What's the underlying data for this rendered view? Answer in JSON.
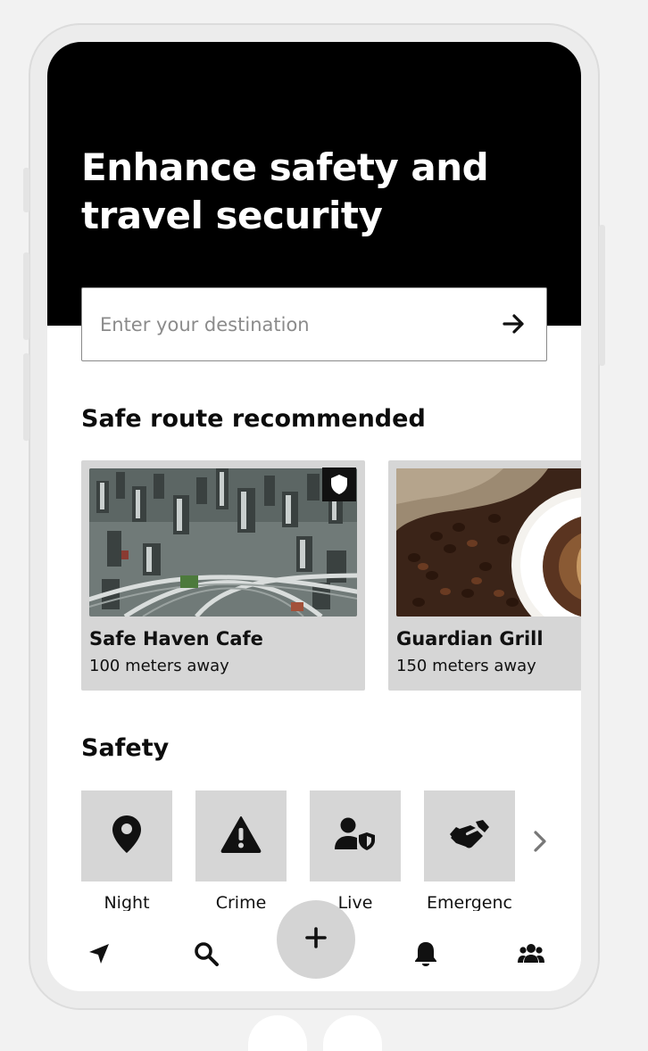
{
  "hero": {
    "title": "Enhance safety and travel security",
    "background": "#000000"
  },
  "search": {
    "placeholder": "Enter your destination",
    "value": "",
    "submit_icon": "arrow-right-icon"
  },
  "safe_routes": {
    "heading": "Safe route recommended",
    "cards": [
      {
        "name": "Safe Haven Cafe",
        "distance": "100 meters away",
        "image": "aerial-city-photo",
        "badge_icon": "shield-icon"
      },
      {
        "name": "Guardian Grill",
        "distance": "150 meters away",
        "image": "coffee-beans-photo"
      }
    ]
  },
  "safety": {
    "heading": "Safety",
    "items": [
      {
        "label": "Night",
        "icon": "location-pin-icon"
      },
      {
        "label": "Crime",
        "icon": "warning-icon"
      },
      {
        "label": "Live",
        "icon": "user-shield-icon"
      },
      {
        "label": "Emergenc",
        "icon": "handshake-icon"
      }
    ],
    "more_icon": "chevron-right-icon"
  },
  "bottom_nav": {
    "items": [
      {
        "icon": "navigation-arrow-icon"
      },
      {
        "icon": "search-icon"
      },
      {
        "icon": "plus-icon"
      },
      {
        "icon": "bell-icon"
      },
      {
        "icon": "users-icon"
      }
    ]
  },
  "colors": {
    "accent": "#000000",
    "tile": "#d6d6d6",
    "fab": "#d4d4d4"
  }
}
